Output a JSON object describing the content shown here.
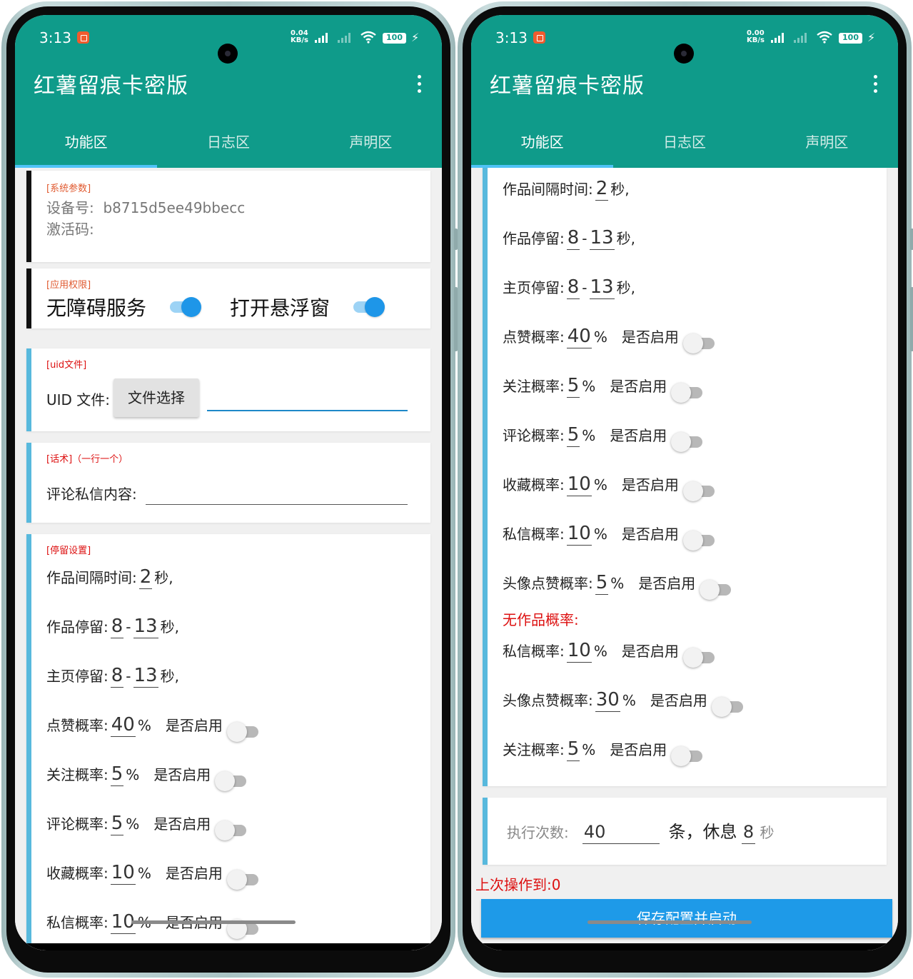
{
  "left": {
    "status": {
      "time": "3:13",
      "speed_value": "0.04",
      "speed_unit": "KB/s",
      "battery": "100"
    },
    "app_title": "红薯留痕卡密版",
    "tabs": [
      "功能区",
      "日志区",
      "声明区"
    ],
    "system_card": {
      "tag": "[系统参数]",
      "device_label": "设备号:",
      "device_id": "b8715d5ee49bbecc",
      "activation_label": "激活码:"
    },
    "permission_card": {
      "tag": "[应用权限]",
      "accessibility": "无障碍服务",
      "accessibility_on": true,
      "floating": "打开悬浮窗",
      "floating_on": true
    },
    "uid_card": {
      "tag": "[uid文件]",
      "label": "UID 文件:",
      "button": "文件选择"
    },
    "script_card": {
      "tag": "[话术]（一行一个）",
      "label": "评论私信内容:"
    },
    "stay_card": {
      "tag": "[停留设置]",
      "interval": {
        "label": "作品间隔时间:",
        "value": "2",
        "unit": "秒,"
      },
      "work_stay": {
        "label": "作品停留:",
        "min": "8",
        "sep": "-",
        "max": "13",
        "unit": "秒,"
      },
      "home_stay": {
        "label": "主页停留:",
        "min": "8",
        "sep": "-",
        "max": "13",
        "unit": "秒,"
      },
      "rates": [
        {
          "label": "点赞概率:",
          "value": "40",
          "unit": "%",
          "enable": "是否启用",
          "on": false
        },
        {
          "label": "关注概率:",
          "value": "5",
          "unit": "%",
          "enable": "是否启用",
          "on": false
        },
        {
          "label": "评论概率:",
          "value": "5",
          "unit": "%",
          "enable": "是否启用",
          "on": false
        },
        {
          "label": "收藏概率:",
          "value": "10",
          "unit": "%",
          "enable": "是否启用",
          "on": false
        },
        {
          "label": "私信概率:",
          "value": "10",
          "unit": "%",
          "enable": "是否启用",
          "on": false
        }
      ]
    }
  },
  "right": {
    "status": {
      "time": "3:13",
      "speed_value": "0.00",
      "speed_unit": "KB/s",
      "battery": "100"
    },
    "app_title": "红薯留痕卡密版",
    "tabs": [
      "功能区",
      "日志区",
      "声明区"
    ],
    "interval": {
      "label": "作品间隔时间:",
      "value": "2",
      "unit": "秒,"
    },
    "work_stay": {
      "label": "作品停留:",
      "min": "8",
      "sep": "-",
      "max": "13",
      "unit": "秒,"
    },
    "home_stay": {
      "label": "主页停留:",
      "min": "8",
      "sep": "-",
      "max": "13",
      "unit": "秒,"
    },
    "rates": [
      {
        "label": "点赞概率:",
        "value": "40",
        "unit": "%",
        "enable": "是否启用",
        "on": false
      },
      {
        "label": "关注概率:",
        "value": "5",
        "unit": "%",
        "enable": "是否启用",
        "on": false
      },
      {
        "label": "评论概率:",
        "value": "5",
        "unit": "%",
        "enable": "是否启用",
        "on": false
      },
      {
        "label": "收藏概率:",
        "value": "10",
        "unit": "%",
        "enable": "是否启用",
        "on": false
      },
      {
        "label": "私信概率:",
        "value": "10",
        "unit": "%",
        "enable": "是否启用",
        "on": false
      },
      {
        "label": "头像点赞概率:",
        "value": "5",
        "unit": "%",
        "enable": "是否启用",
        "on": false
      }
    ],
    "no_work_label": "无作品概率:",
    "no_work_rates": [
      {
        "label": "私信概率:",
        "value": "10",
        "unit": "%",
        "enable": "是否启用",
        "on": false
      },
      {
        "label": "头像点赞概率:",
        "value": "30",
        "unit": "%",
        "enable": "是否启用",
        "on": false
      },
      {
        "label": "关注概率:",
        "value": "5",
        "unit": "%",
        "enable": "是否启用",
        "on": false
      }
    ],
    "exec": {
      "label": "执行次数:",
      "count": "40",
      "mid": "条，休息",
      "rest": "8",
      "unit": "秒"
    },
    "last_op": "上次操作到:0",
    "save_button": "保存配置并启动"
  },
  "colors": {
    "header": "#0f9b8a",
    "accent_blue": "#1e9ae8",
    "tag_orange": "#e05a30",
    "warn_red": "#dd1111"
  }
}
